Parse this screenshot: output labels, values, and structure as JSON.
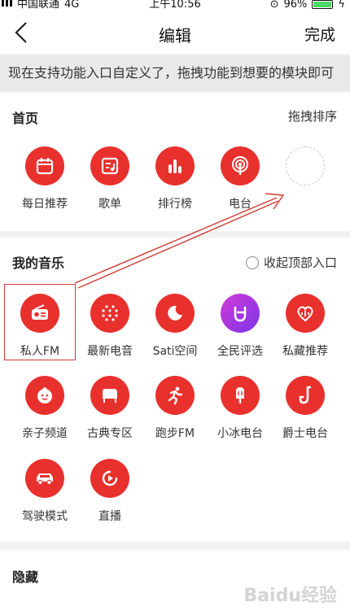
{
  "status": {
    "carrier": "中国联通",
    "network": "4G",
    "time": "上午10:56",
    "battery": "96%",
    "battery_level": 0.96
  },
  "nav": {
    "title": "编辑",
    "done": "完成"
  },
  "tip": "现在支持功能入口自定义了，拖拽功能到想要的模块即可",
  "home": {
    "title": "首页",
    "action": "拖拽排序",
    "items": [
      "每日推荐",
      "歌单",
      "排行榜",
      "电台"
    ]
  },
  "my_music": {
    "title": "我的音乐",
    "toggle": "收起顶部入口",
    "items": [
      "私人FM",
      "最新电音",
      "Sati空间",
      "全民评选",
      "私藏推荐",
      "亲子频道",
      "古典专区",
      "跑步FM",
      "小冰电台",
      "爵士电台",
      "驾驶模式",
      "直播"
    ]
  },
  "hidden": {
    "title": "隐藏"
  },
  "watermark": "Baidu经验",
  "colors": {
    "accent": "#e8302d",
    "purple": "#9a38e0"
  }
}
